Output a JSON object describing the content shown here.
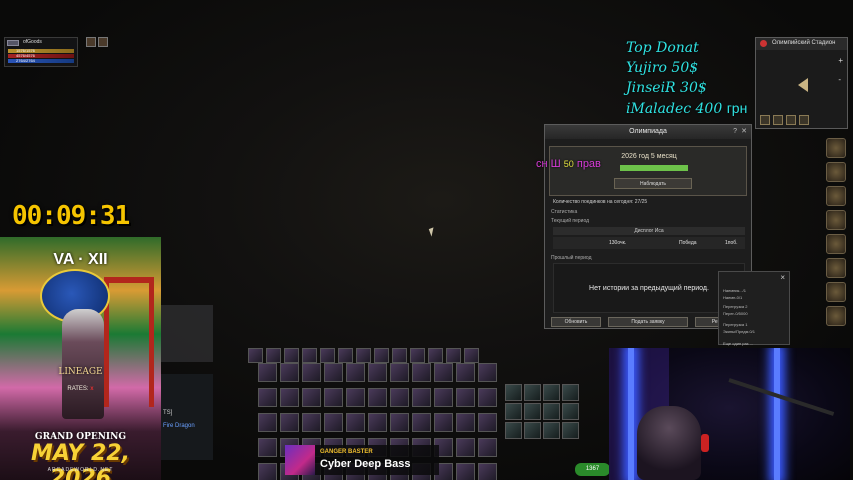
{
  "character": {
    "name": "ofGoods",
    "cp": "1576/1576",
    "hp": "4576/4576",
    "mp": "2764/2764"
  },
  "timer": "00:09:31",
  "poster": {
    "logo": "VA · XII",
    "brand": "LINEAGE",
    "rates_label": "RATES:",
    "rates_value": "x",
    "grand_opening": "GRAND OPENING",
    "date": "MAY 22, 2026",
    "site": "ARCADEWORLD.NET"
  },
  "chat": {
    "line1": "TS]",
    "line2": "Fire Dragon"
  },
  "donate": {
    "title": "Top Donat",
    "entries": [
      "Yujiro 50$",
      "JinseiR 30$"
    ],
    "last_name": "iMaladec 400",
    "last_currency": "грн"
  },
  "minimap": {
    "title": "Олимпийский Стадион",
    "zoom_in": "+",
    "zoom_out": "-"
  },
  "olympiad": {
    "title": "Олимпиада",
    "season": "2026 год 5 месяц",
    "watch_label": "Наблюдать",
    "duels_today": "Количество поединков на сегодня: 27/25",
    "stats_label": "Статистика",
    "current_period": "Текущий период",
    "class_header": "Дисплог Иса",
    "row_points": "130очк.",
    "row_wins": "Победа",
    "row_losses": "1поб.",
    "prev_period": "Прошлый период",
    "no_history": "Нет истории за предыдущий период.",
    "refresh_btn": "Обновить",
    "apply_btn": "Подать заявку",
    "rating_btn": "Рейтинг"
  },
  "overlay": {
    "prefix": "сн Ш",
    "number": "50",
    "suffix": "прав"
  },
  "clan_panel": {
    "close": "×",
    "lines": [
      "Наемник.../1",
      "Наемн-0/1",
      "Перегрузка 2",
      "Перег-0/5000",
      "Перегрузка 1",
      "Экипы/Предм.0/1",
      "Еще один раз ..."
    ]
  },
  "music": {
    "artist": "GANGER BASTER",
    "song": "Cyber Deep Bass"
  },
  "exp": "1367"
}
